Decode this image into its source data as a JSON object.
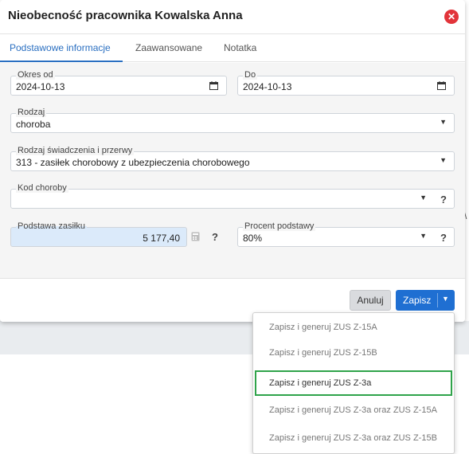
{
  "modal": {
    "title": "Nieobecność pracownika Kowalska Anna",
    "close_icon": "close-icon"
  },
  "tabs": [
    {
      "label": "Podstawowe informacje",
      "active": true
    },
    {
      "label": "Zaawansowane",
      "active": false
    },
    {
      "label": "Notatka",
      "active": false
    }
  ],
  "form": {
    "okres_od": {
      "label": "Okres od",
      "value": "2024-10-13",
      "icon": "calendar-icon"
    },
    "do": {
      "label": "Do",
      "value": "2024-10-13",
      "icon": "calendar-icon"
    },
    "rodzaj": {
      "label": "Rodzaj",
      "value": "choroba"
    },
    "rodzaj_swiadczenia": {
      "label": "Rodzaj świadczenia i przerwy",
      "value": "313 - zasiłek chorobowy z ubezpieczenia chorobowego"
    },
    "kod_choroby": {
      "label": "Kod choroby",
      "value": "",
      "help": "?"
    },
    "podstawa_zasilku": {
      "label": "Podstawa zasiłku",
      "value": "5 177,40",
      "icon": "calculator-icon",
      "help": "?"
    },
    "procent_podstawy": {
      "label": "Procent podstawy",
      "value": "80%",
      "help": "?"
    }
  },
  "footer": {
    "cancel_label": "Anuluj",
    "save_label": "Zapisz"
  },
  "save_dropdown": {
    "items": [
      {
        "label": "Zapisz i generuj ZUS Z-15A",
        "highlighted": false
      },
      {
        "label": "Zapisz i generuj ZUS Z-15B",
        "highlighted": false
      },
      {
        "label": "Zapisz i generuj ZUS Z-3a",
        "highlighted": true
      },
      {
        "label": "Zapisz i generuj ZUS Z-3a oraz ZUS Z-15A",
        "highlighted": false
      },
      {
        "label": "Zapisz i generuj ZUS Z-3a oraz ZUS Z-15B",
        "highlighted": false
      }
    ]
  },
  "colors": {
    "accent": "#1f6fd2",
    "tab_active": "#2a6fc1",
    "close": "#e2343a",
    "highlight_border": "#2fa34a"
  }
}
